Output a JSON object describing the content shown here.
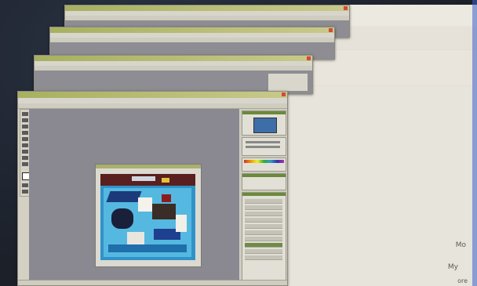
{
  "scene": {
    "description_kind": "photo of stacked image-editor windows projected on a wall"
  },
  "windows": [
    {
      "id": "window-back-1"
    },
    {
      "id": "window-back-2"
    },
    {
      "id": "window-back-3"
    },
    {
      "id": "window-front"
    }
  ],
  "colors": {
    "title_bar": "#a7b060",
    "workspace_gray": "#8a8890",
    "artwork_blue": "#2f93c9",
    "close_button": "#d44a3a",
    "paper": "#e9e6dd"
  },
  "front_window": {
    "panels": [
      "navigator-panel",
      "color-swatches-panel",
      "layers-panel"
    ],
    "document": {
      "kind": "collage artwork"
    }
  },
  "page_edge_text": [
    "Mo",
    "My",
    "ore"
  ]
}
